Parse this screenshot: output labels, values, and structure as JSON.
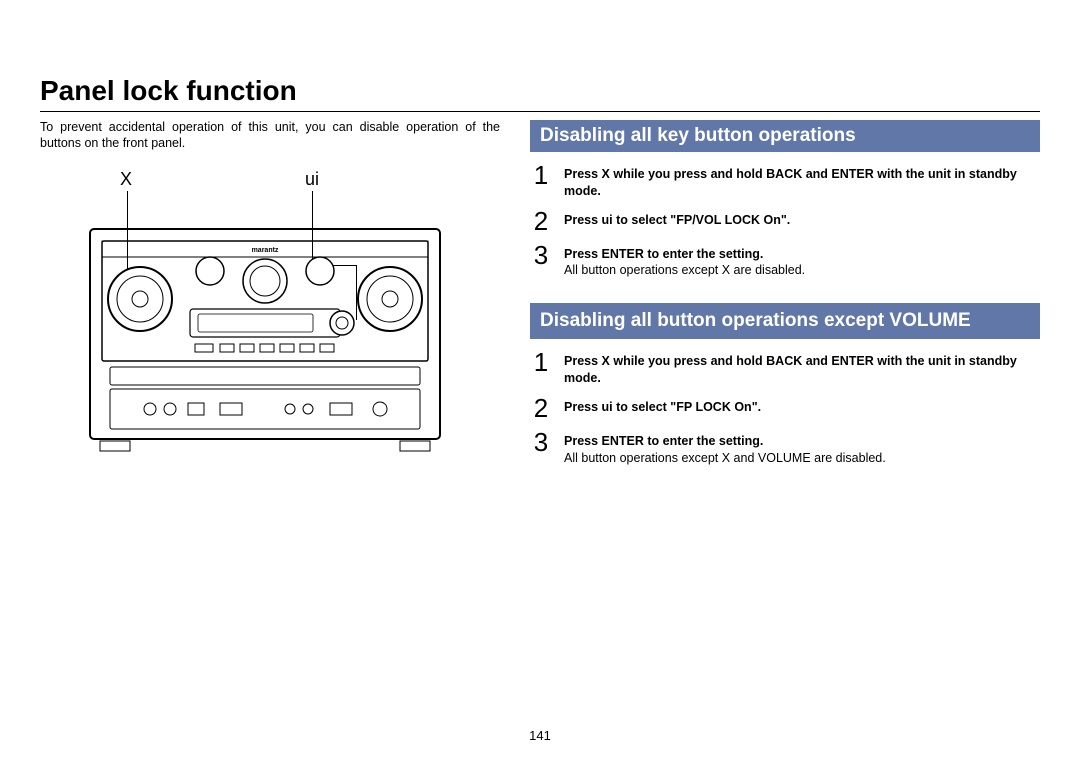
{
  "page": {
    "title": "Panel lock function",
    "intro": "To prevent accidental operation of this unit, you can disable operation of the buttons on the front panel.",
    "page_number": "141"
  },
  "diagram": {
    "callout_left": "X",
    "callout_right": "ui",
    "brand": "marantz"
  },
  "section1": {
    "heading": "Disabling all key button operations",
    "steps": [
      {
        "num": "1",
        "bold": "Press X while you press and hold BACK and ENTER with the unit in standby mode.",
        "note": ""
      },
      {
        "num": "2",
        "bold": "Press ui to select \"FP/VOL LOCK On\".",
        "note": ""
      },
      {
        "num": "3",
        "bold": "Press ENTER to enter the setting.",
        "note": "All button operations except X are disabled."
      }
    ]
  },
  "section2": {
    "heading": "Disabling all button operations except VOLUME",
    "steps": [
      {
        "num": "1",
        "bold": "Press X while you press and hold BACK and ENTER with the unit in standby mode.",
        "note": ""
      },
      {
        "num": "2",
        "bold": "Press ui to select \"FP LOCK On\".",
        "note": ""
      },
      {
        "num": "3",
        "bold": "Press ENTER to enter the setting.",
        "note": "All button operations except X and VOLUME are disabled."
      }
    ]
  }
}
